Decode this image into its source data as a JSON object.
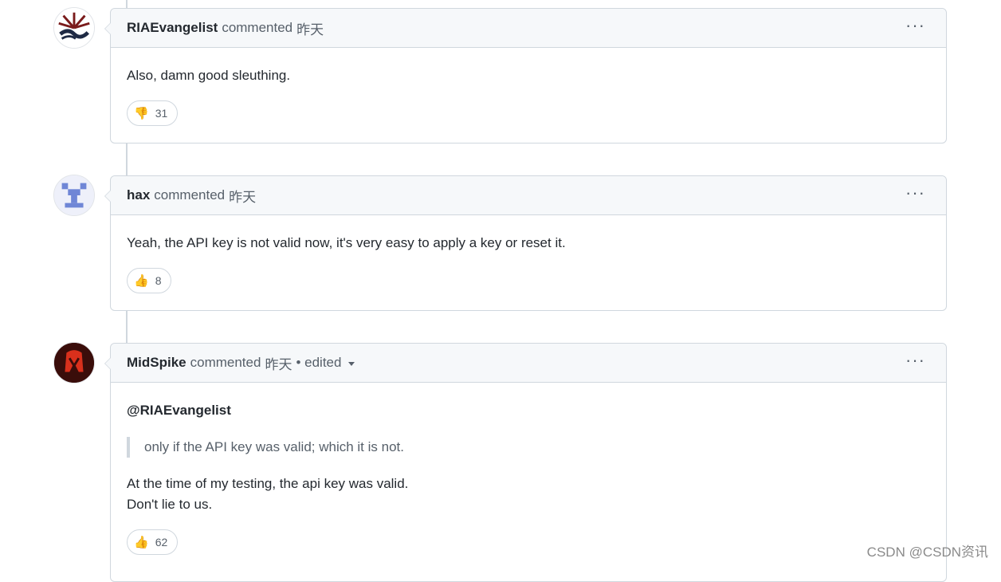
{
  "comments": [
    {
      "author": "RIAEvangelist",
      "action": "commented",
      "time": "昨天",
      "body": "Also, damn good sleuthing.",
      "reaction": {
        "emoji": "👎",
        "icon": "thumbs-down",
        "count": "31"
      }
    },
    {
      "author": "hax",
      "action": "commented",
      "time": "昨天",
      "body": "Yeah, the API key is not valid now, it's very easy to apply a key or reset it.",
      "reaction": {
        "emoji": "👍",
        "icon": "thumbs-up",
        "count": "8"
      }
    },
    {
      "author": "MidSpike",
      "action": "commented",
      "time": "昨天",
      "edited": "• edited",
      "mention": "@RIAEvangelist",
      "quote": "only if the API key was valid; which it is not.",
      "line1": "At the time of my testing, the api key was valid.",
      "line2": "Don't lie to us.",
      "reaction": {
        "emoji": "👍",
        "icon": "thumbs-up",
        "count": "62"
      }
    }
  ],
  "more_icon": "···",
  "watermark": "CSDN @CSDN资讯"
}
